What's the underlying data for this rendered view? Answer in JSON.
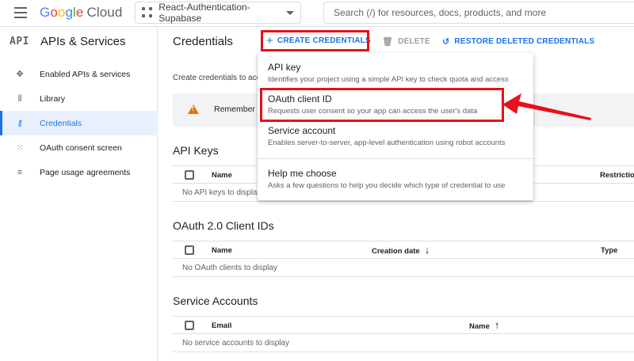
{
  "topbar": {
    "logo": {
      "brand_letters": [
        "G",
        "o",
        "o",
        "g",
        "l",
        "e"
      ],
      "product": "Cloud"
    },
    "project_name": "React-Authentication-Supabase",
    "search_placeholder": "Search (/) for resources, docs, products, and more"
  },
  "sidebar": {
    "badge": "API",
    "title": "APIs & Services",
    "items": [
      {
        "label": "Enabled APIs & services",
        "icon": "diamond-icon",
        "active": false
      },
      {
        "label": "Library",
        "icon": "library-icon",
        "active": false
      },
      {
        "label": "Credentials",
        "icon": "key-icon",
        "active": true
      },
      {
        "label": "OAuth consent screen",
        "icon": "consent-icon",
        "active": false
      },
      {
        "label": "Page usage agreements",
        "icon": "settings-list-icon",
        "active": false
      }
    ]
  },
  "header": {
    "title": "Credentials",
    "create_label": "CREATE CREDENTIALS",
    "delete_label": "DELETE",
    "restore_label": "RESTORE DELETED CREDENTIALS"
  },
  "main": {
    "description": "Create credentials to acc",
    "banner_text": "Remember t",
    "api_keys": {
      "title": "API Keys",
      "columns": [
        "Name",
        "Restriction"
      ],
      "empty": "No API keys to displa"
    },
    "oauth": {
      "title": "OAuth 2.0 Client IDs",
      "columns": [
        "Name",
        "Creation date",
        "Type"
      ],
      "empty": "No OAuth clients to display"
    },
    "service_accounts": {
      "title": "Service Accounts",
      "columns": [
        "Email",
        "Name"
      ],
      "empty": "No service accounts to display"
    }
  },
  "dropdown": {
    "items": [
      {
        "title": "API key",
        "desc": "Identifies your project using a simple API key to check quota and access"
      },
      {
        "title": "OAuth client ID",
        "desc": "Requests user consent so your app can access the user's data"
      },
      {
        "title": "Service account",
        "desc": "Enables server-to-server, app-level authentication using robot accounts"
      },
      {
        "title": "Help me choose",
        "desc": "Asks a few questions to help you decide which type of credential to use"
      }
    ]
  },
  "colors": {
    "accent": "#1a73e8",
    "highlight": "#e8101a",
    "warning": "#e37400"
  }
}
